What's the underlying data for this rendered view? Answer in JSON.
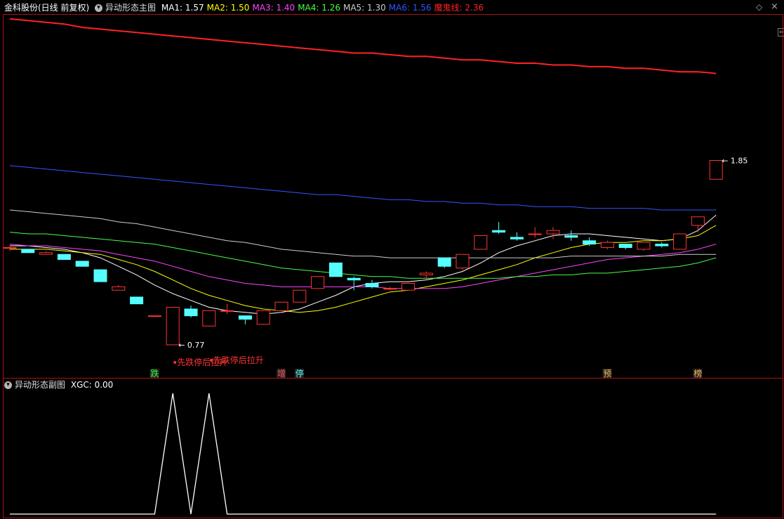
{
  "main_header": {
    "stock": "金科股份(日线 前复权)",
    "indicator": "异动形态主图",
    "ma_labels": [
      {
        "text": "MA1: 1.57",
        "color": "#ffffff"
      },
      {
        "text": "MA2: 1.50",
        "color": "#ffff00"
      },
      {
        "text": "MA3: 1.40",
        "color": "#ff44ff"
      },
      {
        "text": "MA4: 1.26",
        "color": "#44ff44"
      },
      {
        "text": "MA5: 1.30",
        "color": "#cccccc"
      },
      {
        "text": "MA6: 1.56",
        "color": "#3355ff"
      },
      {
        "text": "魔鬼线: 2.36",
        "color": "#ff2222"
      }
    ]
  },
  "sub_header": {
    "indicator": "异动形态副图",
    "value_text": "XGC: 0.00"
  },
  "icons": {
    "expand": "chevron-down-icon",
    "settings": "diamond-icon",
    "close": "close-icon"
  },
  "colors": {
    "up": "#ff3333",
    "down": "#55ffff",
    "ma1": "#ffffff",
    "ma2": "#ffff00",
    "ma3": "#ff44ff",
    "ma4": "#44ff44",
    "ma5": "#cccccc",
    "ma6": "#3355ff",
    "devil": "#ff2222",
    "frame": "#aa1111"
  },
  "chart_data": [
    {
      "type": "candlestick",
      "ylim": [
        0.7,
        2.7
      ],
      "candles": [
        {
          "o": 1.34,
          "h": 1.35,
          "l": 1.32,
          "c": 1.34
        },
        {
          "o": 1.33,
          "h": 1.33,
          "l": 1.31,
          "c": 1.31
        },
        {
          "o": 1.3,
          "h": 1.32,
          "l": 1.3,
          "c": 1.31
        },
        {
          "o": 1.3,
          "h": 1.3,
          "l": 1.27,
          "c": 1.27
        },
        {
          "o": 1.26,
          "h": 1.26,
          "l": 1.23,
          "c": 1.23
        },
        {
          "o": 1.21,
          "h": 1.21,
          "l": 1.14,
          "c": 1.14
        },
        {
          "o": 1.09,
          "h": 1.12,
          "l": 1.09,
          "c": 1.11
        },
        {
          "o": 1.05,
          "h": 1.05,
          "l": 1.01,
          "c": 1.01
        },
        {
          "o": 0.94,
          "h": 0.94,
          "l": 0.94,
          "c": 0.94
        },
        {
          "o": 0.77,
          "h": 0.99,
          "l": 0.77,
          "c": 0.99
        },
        {
          "o": 0.98,
          "h": 1.0,
          "l": 0.93,
          "c": 0.94
        },
        {
          "o": 0.88,
          "h": 0.97,
          "l": 0.88,
          "c": 0.97
        },
        {
          "o": 0.97,
          "h": 1.01,
          "l": 0.95,
          "c": 0.97
        },
        {
          "o": 0.94,
          "h": 0.94,
          "l": 0.89,
          "c": 0.92
        },
        {
          "o": 0.89,
          "h": 0.97,
          "l": 0.89,
          "c": 0.97
        },
        {
          "o": 0.97,
          "h": 1.02,
          "l": 0.97,
          "c": 1.02
        },
        {
          "o": 1.02,
          "h": 1.09,
          "l": 1.02,
          "c": 1.09
        },
        {
          "o": 1.1,
          "h": 1.17,
          "l": 1.1,
          "c": 1.17
        },
        {
          "o": 1.25,
          "h": 1.25,
          "l": 1.17,
          "c": 1.17
        },
        {
          "o": 1.16,
          "h": 1.17,
          "l": 1.09,
          "c": 1.15
        },
        {
          "o": 1.13,
          "h": 1.15,
          "l": 1.1,
          "c": 1.11
        },
        {
          "o": 1.1,
          "h": 1.11,
          "l": 1.09,
          "c": 1.1
        },
        {
          "o": 1.09,
          "h": 1.13,
          "l": 1.09,
          "c": 1.13
        },
        {
          "o": 1.18,
          "h": 1.2,
          "l": 1.15,
          "c": 1.19
        },
        {
          "o": 1.28,
          "h": 1.28,
          "l": 1.22,
          "c": 1.23
        },
        {
          "o": 1.22,
          "h": 1.3,
          "l": 1.21,
          "c": 1.3
        },
        {
          "o": 1.33,
          "h": 1.41,
          "l": 1.33,
          "c": 1.41
        },
        {
          "o": 1.44,
          "h": 1.49,
          "l": 1.42,
          "c": 1.43
        },
        {
          "o": 1.4,
          "h": 1.43,
          "l": 1.38,
          "c": 1.39
        },
        {
          "o": 1.42,
          "h": 1.46,
          "l": 1.4,
          "c": 1.42
        },
        {
          "o": 1.42,
          "h": 1.46,
          "l": 1.39,
          "c": 1.44
        },
        {
          "o": 1.41,
          "h": 1.44,
          "l": 1.38,
          "c": 1.4
        },
        {
          "o": 1.38,
          "h": 1.4,
          "l": 1.35,
          "c": 1.36
        },
        {
          "o": 1.34,
          "h": 1.38,
          "l": 1.33,
          "c": 1.37
        },
        {
          "o": 1.36,
          "h": 1.36,
          "l": 1.33,
          "c": 1.34
        },
        {
          "o": 1.33,
          "h": 1.37,
          "l": 1.32,
          "c": 1.37
        },
        {
          "o": 1.36,
          "h": 1.37,
          "l": 1.34,
          "c": 1.35
        },
        {
          "o": 1.33,
          "h": 1.42,
          "l": 1.33,
          "c": 1.42
        },
        {
          "o": 1.47,
          "h": 1.52,
          "l": 1.43,
          "c": 1.52
        },
        {
          "o": 1.74,
          "h": 1.85,
          "l": 1.74,
          "c": 1.85
        }
      ],
      "ma_series": [
        {
          "name": "MA1",
          "color": "#ffffff",
          "values": [
            1.35,
            1.35,
            1.34,
            1.33,
            1.31,
            1.28,
            1.23,
            1.18,
            1.12,
            1.07,
            1.03,
            0.99,
            0.97,
            0.96,
            0.95,
            0.96,
            0.98,
            1.02,
            1.06,
            1.11,
            1.13,
            1.14,
            1.14,
            1.15,
            1.17,
            1.2,
            1.25,
            1.31,
            1.35,
            1.38,
            1.41,
            1.42,
            1.42,
            1.41,
            1.4,
            1.39,
            1.38,
            1.39,
            1.44,
            1.53
          ]
        },
        {
          "name": "MA2",
          "color": "#ffff00",
          "values": [
            1.33,
            1.33,
            1.33,
            1.32,
            1.31,
            1.3,
            1.27,
            1.24,
            1.2,
            1.15,
            1.1,
            1.06,
            1.03,
            1.0,
            0.98,
            0.97,
            0.96,
            0.97,
            0.99,
            1.02,
            1.05,
            1.08,
            1.09,
            1.11,
            1.13,
            1.15,
            1.18,
            1.21,
            1.24,
            1.28,
            1.31,
            1.34,
            1.36,
            1.37,
            1.37,
            1.38,
            1.38,
            1.39,
            1.41,
            1.47
          ]
        },
        {
          "name": "MA3",
          "color": "#ff44ff",
          "values": [
            1.36,
            1.35,
            1.35,
            1.34,
            1.33,
            1.32,
            1.3,
            1.28,
            1.26,
            1.23,
            1.2,
            1.17,
            1.15,
            1.13,
            1.12,
            1.11,
            1.11,
            1.11,
            1.11,
            1.11,
            1.11,
            1.1,
            1.1,
            1.1,
            1.1,
            1.11,
            1.13,
            1.15,
            1.17,
            1.19,
            1.21,
            1.23,
            1.25,
            1.27,
            1.28,
            1.29,
            1.3,
            1.31,
            1.33,
            1.36
          ]
        },
        {
          "name": "MA4",
          "color": "#44ff44",
          "values": [
            1.43,
            1.42,
            1.42,
            1.41,
            1.4,
            1.39,
            1.38,
            1.37,
            1.36,
            1.34,
            1.32,
            1.3,
            1.28,
            1.26,
            1.24,
            1.22,
            1.21,
            1.2,
            1.19,
            1.18,
            1.17,
            1.17,
            1.16,
            1.16,
            1.16,
            1.16,
            1.16,
            1.16,
            1.17,
            1.17,
            1.18,
            1.18,
            1.19,
            1.19,
            1.2,
            1.21,
            1.22,
            1.23,
            1.25,
            1.28
          ]
        },
        {
          "name": "MA5",
          "color": "#cccccc",
          "values": [
            1.56,
            1.55,
            1.54,
            1.53,
            1.52,
            1.51,
            1.49,
            1.48,
            1.46,
            1.44,
            1.42,
            1.4,
            1.38,
            1.37,
            1.35,
            1.33,
            1.32,
            1.31,
            1.3,
            1.29,
            1.29,
            1.28,
            1.28,
            1.28,
            1.28,
            1.28,
            1.28,
            1.28,
            1.28,
            1.28,
            1.28,
            1.29,
            1.29,
            1.29,
            1.29,
            1.29,
            1.29,
            1.3,
            1.3,
            1.3
          ]
        },
        {
          "name": "MA6",
          "color": "#3355ff",
          "values": [
            1.82,
            1.81,
            1.8,
            1.79,
            1.78,
            1.77,
            1.76,
            1.75,
            1.74,
            1.73,
            1.72,
            1.71,
            1.7,
            1.69,
            1.68,
            1.67,
            1.66,
            1.65,
            1.65,
            1.64,
            1.63,
            1.62,
            1.62,
            1.61,
            1.61,
            1.6,
            1.6,
            1.59,
            1.59,
            1.58,
            1.58,
            1.58,
            1.57,
            1.57,
            1.57,
            1.57,
            1.56,
            1.56,
            1.56,
            1.56
          ]
        },
        {
          "name": "魔鬼线",
          "color": "#ff2222",
          "values": [
            2.68,
            2.67,
            2.66,
            2.65,
            2.63,
            2.62,
            2.61,
            2.6,
            2.59,
            2.58,
            2.57,
            2.56,
            2.55,
            2.54,
            2.53,
            2.52,
            2.51,
            2.5,
            2.49,
            2.48,
            2.48,
            2.47,
            2.46,
            2.46,
            2.45,
            2.44,
            2.44,
            2.43,
            2.42,
            2.42,
            2.41,
            2.41,
            2.4,
            2.4,
            2.39,
            2.39,
            2.38,
            2.37,
            2.37,
            2.36
          ]
        }
      ],
      "price_labels": [
        {
          "index": 9,
          "text": "0.77"
        },
        {
          "index": 39,
          "text": "1.85"
        }
      ],
      "annotations": [
        {
          "index": 9,
          "text": "先跌停后拉升"
        },
        {
          "index": 11,
          "text": "先跌停后拉升"
        }
      ],
      "signals": [
        {
          "index": 8,
          "text": "跌",
          "color": "#33ff33"
        },
        {
          "index": 15,
          "text": "增",
          "color": "#ff5555"
        },
        {
          "index": 16,
          "text": "停",
          "color": "#55ffff"
        },
        {
          "index": 33,
          "text": "预",
          "color": "#ffbb55"
        },
        {
          "index": 38,
          "text": "榜",
          "color": "#ffbb55"
        }
      ]
    },
    {
      "type": "line",
      "name": "XGC",
      "ylim": [
        0,
        1
      ],
      "values": [
        0,
        0,
        0,
        0,
        0,
        0,
        0,
        0,
        0,
        1,
        0,
        1,
        0,
        0,
        0,
        0,
        0,
        0,
        0,
        0,
        0,
        0,
        0,
        0,
        0,
        0,
        0,
        0,
        0,
        0,
        0,
        0,
        0,
        0,
        0,
        0,
        0,
        0,
        0,
        0
      ]
    }
  ]
}
